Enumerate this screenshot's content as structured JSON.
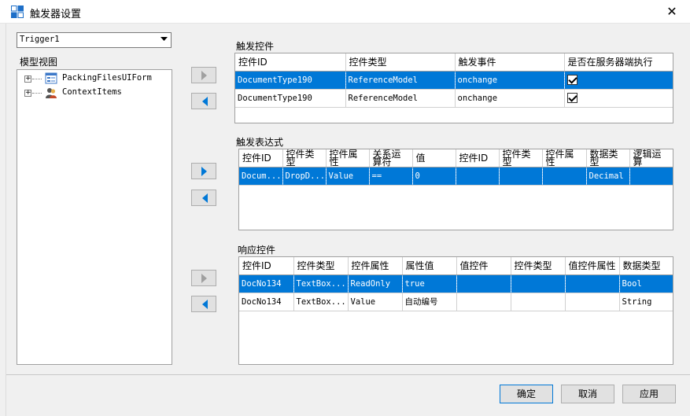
{
  "window": {
    "title": "触发器设置",
    "close": "✕"
  },
  "trigger_select": {
    "value": "Trigger1"
  },
  "model_view": {
    "label": "模型视图",
    "nodes": [
      {
        "label": "PackingFilesUIForm",
        "icon": "form-icon"
      },
      {
        "label": "ContextItems",
        "icon": "users-icon"
      }
    ]
  },
  "trigger_controls": {
    "title": "触发控件",
    "columns": [
      "控件ID",
      "控件类型",
      "触发事件",
      "是否在服务器端执行"
    ],
    "rows": [
      [
        "DocumentType190",
        "ReferenceModel",
        "onchange",
        true
      ],
      [
        "DocumentType190",
        "ReferenceModel",
        "onchange",
        true
      ]
    ]
  },
  "trigger_expression": {
    "title": "触发表达式",
    "columns": [
      "控件ID",
      "控件类型",
      "控件属性",
      "关系运算符",
      "值",
      "控件ID",
      "控件类型",
      "控件属性",
      "数据类型",
      "逻辑运算"
    ],
    "rows": [
      [
        "Docum...",
        "DropD...",
        "Value",
        "==",
        "0",
        "",
        "",
        "",
        "Decimal",
        ""
      ]
    ]
  },
  "response_controls": {
    "title": "响应控件",
    "columns": [
      "控件ID",
      "控件类型",
      "控件属性",
      "属性值",
      "值控件",
      "控件类型",
      "值控件属性",
      "数据类型"
    ],
    "rows": [
      [
        "DocNo134",
        "TextBox...",
        "ReadOnly",
        "true",
        "",
        "",
        "",
        "Bool"
      ],
      [
        "DocNo134",
        "TextBox...",
        "Value",
        "自动编号",
        "",
        "",
        "",
        "String"
      ]
    ]
  },
  "buttons": {
    "ok": "确定",
    "cancel": "取消",
    "apply": "应用"
  },
  "colors": {
    "selection": "#0078d7",
    "accent": "#0078d7"
  }
}
